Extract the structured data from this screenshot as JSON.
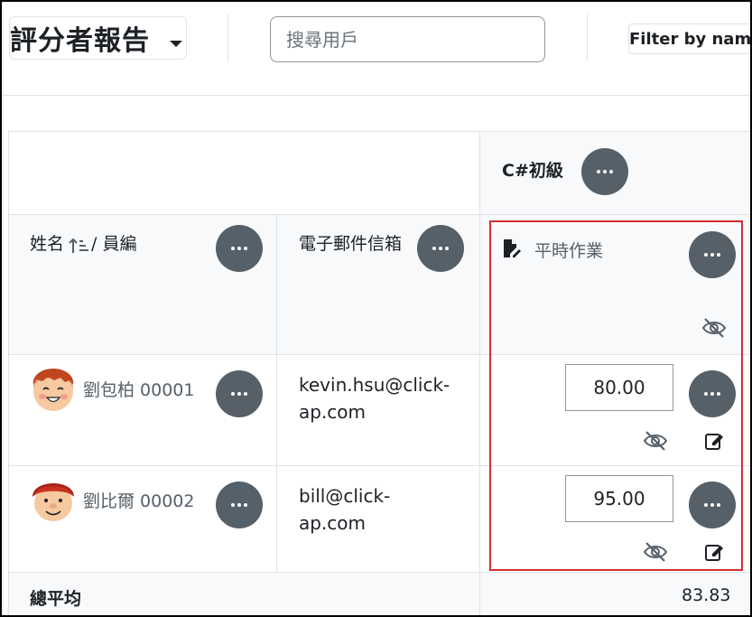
{
  "header": {
    "report_title": "評分者報告",
    "search_placeholder": "搜尋用戶",
    "filter_label": "Filter by name"
  },
  "course": {
    "name": "C#初級"
  },
  "columns": {
    "name_label": "姓名",
    "id_label": "/ 員編",
    "email_label": "電子郵件信箱",
    "assignment_label": "平時作業"
  },
  "rows": [
    {
      "name_id": "劉包柏 00001",
      "email_line1": "kevin.hsu@click-",
      "email_line2": "ap.com",
      "grade": "80.00"
    },
    {
      "name_id": "劉比爾 00002",
      "email_line1": "bill@click-",
      "email_line2": "ap.com",
      "grade": "95.00"
    }
  ],
  "footer": {
    "label": "總平均",
    "average": "83.83"
  },
  "colors": {
    "action_button": "#566069",
    "highlight_border": "#d32f2f",
    "link_text": "#566069"
  },
  "icons": {
    "actions": "ellipsis-icon",
    "sort": "sort-ascending-icon",
    "assignment": "assignment-edit-icon",
    "hidden": "eye-slash-icon",
    "edit": "edit-icon"
  }
}
